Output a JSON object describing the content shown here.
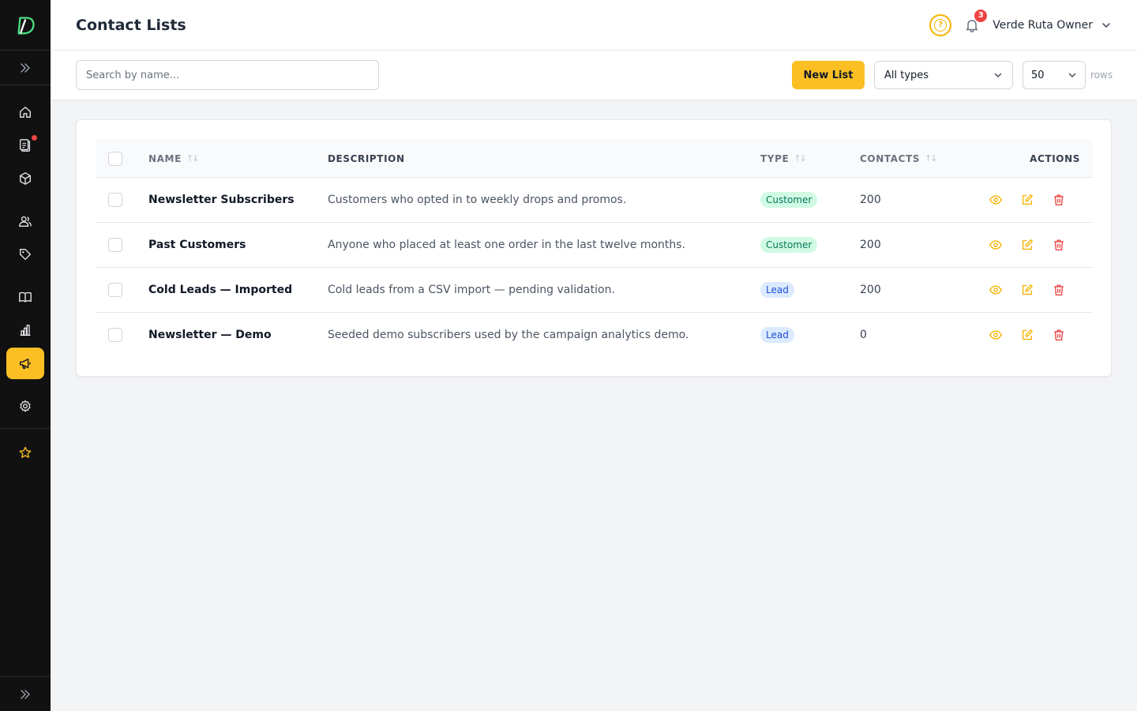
{
  "app": {
    "page_title": "Contact Lists",
    "help_label": "?",
    "notifications_count": "3",
    "user_name": "Verde Ruta Owner"
  },
  "sidebar": {
    "items": [
      {
        "icon": "home-icon",
        "active": false,
        "dot": false
      },
      {
        "icon": "clipboard-icon",
        "active": false,
        "dot": true
      },
      {
        "icon": "box-icon",
        "active": false,
        "dot": false
      },
      {
        "icon": "users-icon",
        "active": false,
        "dot": false
      },
      {
        "icon": "tag-icon",
        "active": false,
        "dot": false
      },
      {
        "icon": "book-icon",
        "active": false,
        "dot": false
      },
      {
        "icon": "bar-chart-icon",
        "active": false,
        "dot": false
      },
      {
        "icon": "megaphone-icon",
        "active": true,
        "dot": false
      },
      {
        "icon": "gear-icon",
        "active": false,
        "dot": false
      },
      {
        "icon": "star-icon",
        "active": false,
        "dot": false
      }
    ]
  },
  "toolbar": {
    "search_placeholder": "Search by name...",
    "new_list_label": "New List",
    "type_filter_value": "All types",
    "rows_value": "50",
    "rows_label": "rows"
  },
  "table": {
    "columns": {
      "name": "NAME",
      "description": "DESCRIPTION",
      "type": "TYPE",
      "contacts": "CONTACTS",
      "actions": "ACTIONS"
    },
    "sort_glyph": "↑↓",
    "rows": [
      {
        "name": "Newsletter Subscribers",
        "description": "Customers who opted in to weekly drops and promos.",
        "type": "Customer",
        "contacts": "200"
      },
      {
        "name": "Past Customers",
        "description": "Anyone who placed at least one order in the last twelve months.",
        "type": "Customer",
        "contacts": "200"
      },
      {
        "name": "Cold Leads — Imported",
        "description": "Cold leads from a CSV import — pending validation.",
        "type": "Lead",
        "contacts": "200"
      },
      {
        "name": "Newsletter — Demo",
        "description": "Seeded demo subscribers used by the campaign analytics demo.",
        "type": "Lead",
        "contacts": "0"
      }
    ]
  },
  "colors": {
    "accent": "#fbbf24",
    "sidebar_bg": "#111111",
    "danger": "#ef4444",
    "customer_badge": "#d1fae5",
    "lead_badge": "#dbeafe"
  }
}
